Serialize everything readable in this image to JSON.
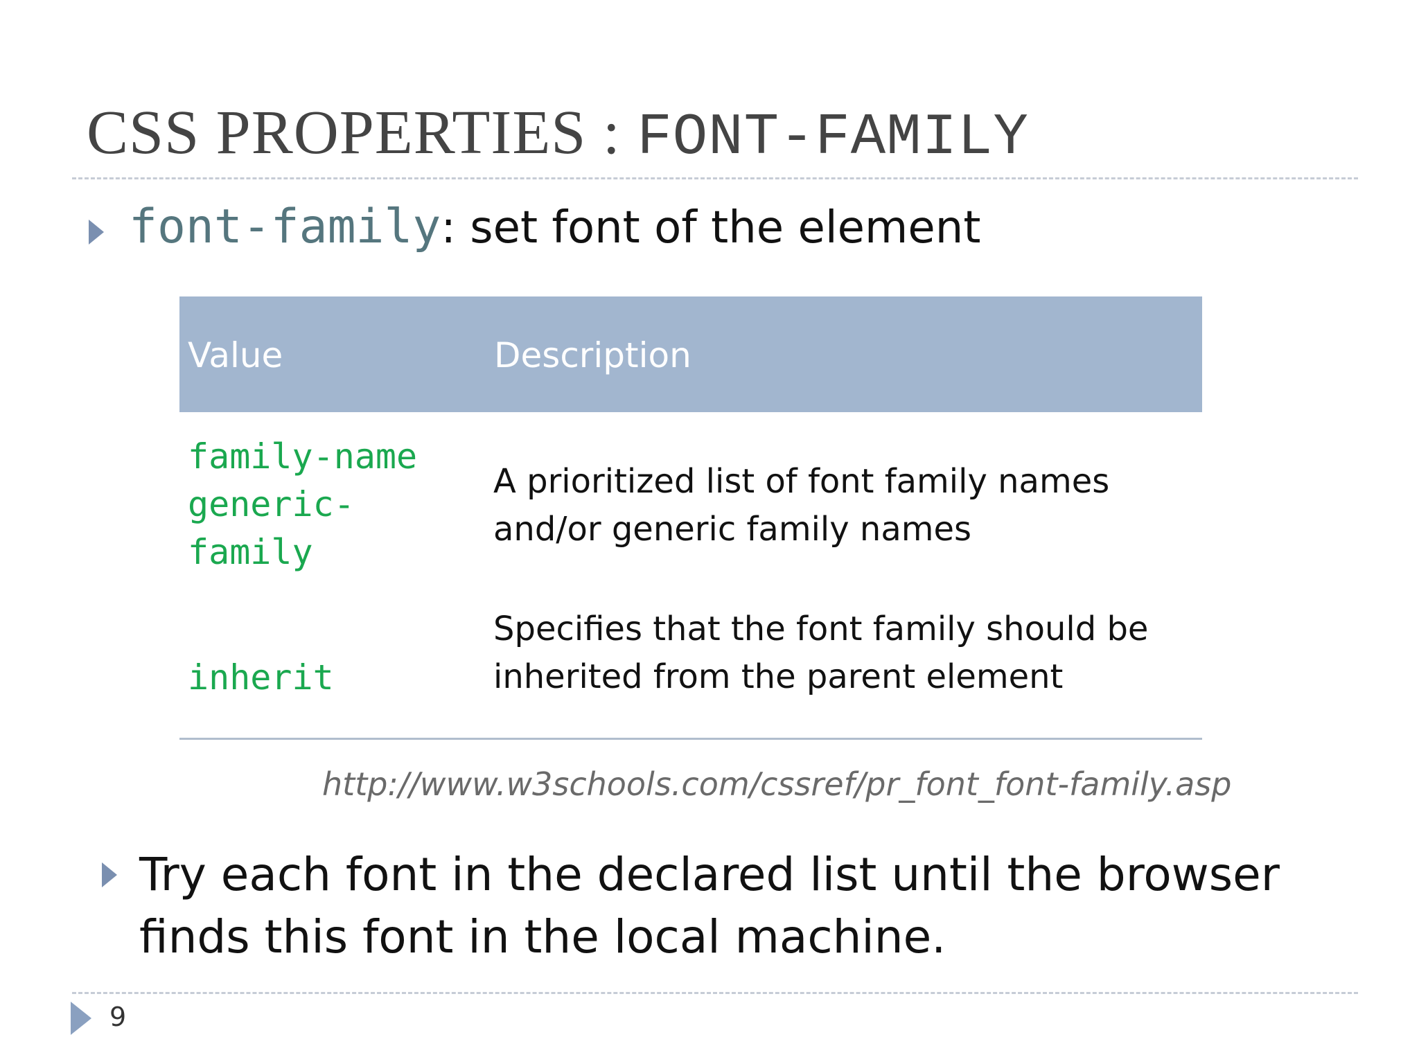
{
  "slide": {
    "title_text": "CSS PROPERTIES : ",
    "title_code": "FONT-FAMILY",
    "bullet1_code": "font-family",
    "bullet1_text": ": set font of the element",
    "table": {
      "headers": [
        "Value",
        "Description"
      ],
      "rows": [
        {
          "values": [
            "family-name",
            "generic-",
            "family"
          ],
          "description": [
            "A prioritized list of font family names",
            "and/or generic family names"
          ]
        },
        {
          "values": [
            "inherit"
          ],
          "description": [
            "Specifies that the font family should be",
            "inherited from the parent element"
          ]
        }
      ]
    },
    "source_url": "http://www.w3schools.com/cssref/pr_font_font-family.asp",
    "bullet2_text": "Try each font in the declared list until the browser finds this font in the local machine.",
    "page_number": "9"
  },
  "colors": {
    "header_bg": "#a2b6cf",
    "value_green": "#1aa84f",
    "code_teal": "#55767e",
    "bullet_blue": "#7a8fb0"
  }
}
